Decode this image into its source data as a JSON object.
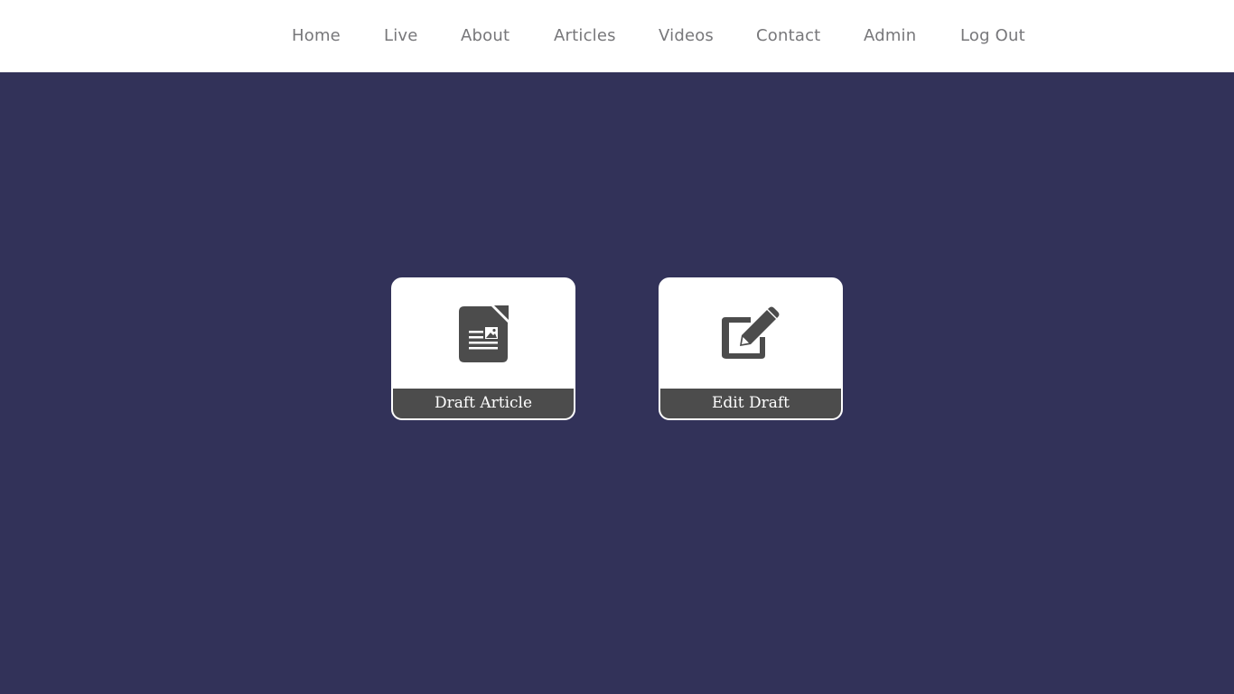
{
  "nav": {
    "items": [
      {
        "label": "Home"
      },
      {
        "label": "Live"
      },
      {
        "label": "About"
      },
      {
        "label": "Articles"
      },
      {
        "label": "Videos"
      },
      {
        "label": "Contact"
      },
      {
        "label": "Admin"
      },
      {
        "label": "Log Out"
      }
    ]
  },
  "cards": [
    {
      "label": "Draft Article",
      "icon": "article-document-icon"
    },
    {
      "label": "Edit Draft",
      "icon": "edit-pencil-icon"
    }
  ],
  "colors": {
    "background": "#323259",
    "nav_background": "#ffffff",
    "nav_text": "#77777a",
    "card_label_bg": "#4c4c4c",
    "icon": "#4c4c4c"
  }
}
